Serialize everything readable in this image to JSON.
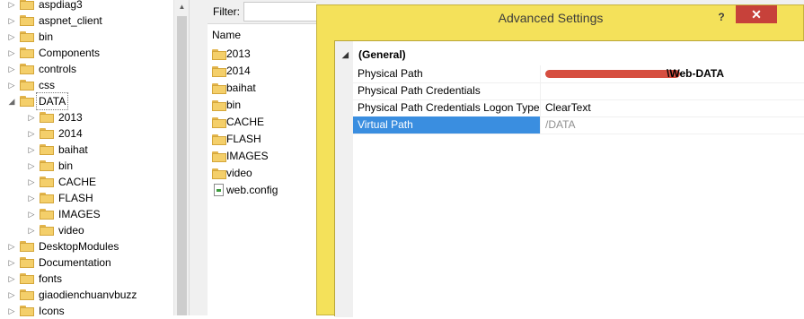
{
  "tree": {
    "items": [
      {
        "label": "aspdiag3",
        "indent": 0
      },
      {
        "label": "aspnet_client",
        "indent": 0
      },
      {
        "label": "bin",
        "indent": 0
      },
      {
        "label": "Components",
        "indent": 0
      },
      {
        "label": "controls",
        "indent": 0
      },
      {
        "label": "css",
        "indent": 0
      },
      {
        "label": "DATA",
        "indent": 0,
        "expanded": true,
        "selected": true
      },
      {
        "label": "2013",
        "indent": 1
      },
      {
        "label": "2014",
        "indent": 1
      },
      {
        "label": "baihat",
        "indent": 1
      },
      {
        "label": "bin",
        "indent": 1
      },
      {
        "label": "CACHE",
        "indent": 1
      },
      {
        "label": "FLASH",
        "indent": 1
      },
      {
        "label": "IMAGES",
        "indent": 1
      },
      {
        "label": "video",
        "indent": 1
      },
      {
        "label": "DesktopModules",
        "indent": 0
      },
      {
        "label": "Documentation",
        "indent": 0
      },
      {
        "label": "fonts",
        "indent": 0
      },
      {
        "label": "giaodienchuanvbuzz",
        "indent": 0
      },
      {
        "label": "Icons",
        "indent": 0
      }
    ]
  },
  "filter": {
    "label": "Filter:",
    "value": ""
  },
  "content": {
    "column_header": "Name",
    "items": [
      {
        "label": "2013",
        "type": "folder"
      },
      {
        "label": "2014",
        "type": "folder"
      },
      {
        "label": "baihat",
        "type": "folder"
      },
      {
        "label": "bin",
        "type": "folder"
      },
      {
        "label": "CACHE",
        "type": "folder"
      },
      {
        "label": "FLASH",
        "type": "folder"
      },
      {
        "label": "IMAGES",
        "type": "folder"
      },
      {
        "label": "video",
        "type": "folder"
      },
      {
        "label": "web.config",
        "type": "file"
      }
    ]
  },
  "dialog": {
    "title": "Advanced Settings",
    "help_label": "?",
    "close_label": "✕",
    "section": "(General)",
    "properties": [
      {
        "name": "Physical Path",
        "value": "\\Web-DATA",
        "redacted": true,
        "style": "bold"
      },
      {
        "name": "Physical Path Credentials",
        "value": ""
      },
      {
        "name": "Physical Path Credentials Logon Type",
        "value": "ClearText"
      },
      {
        "name": "Virtual Path",
        "value": "/DATA",
        "selected": true,
        "style": "muted"
      }
    ]
  }
}
